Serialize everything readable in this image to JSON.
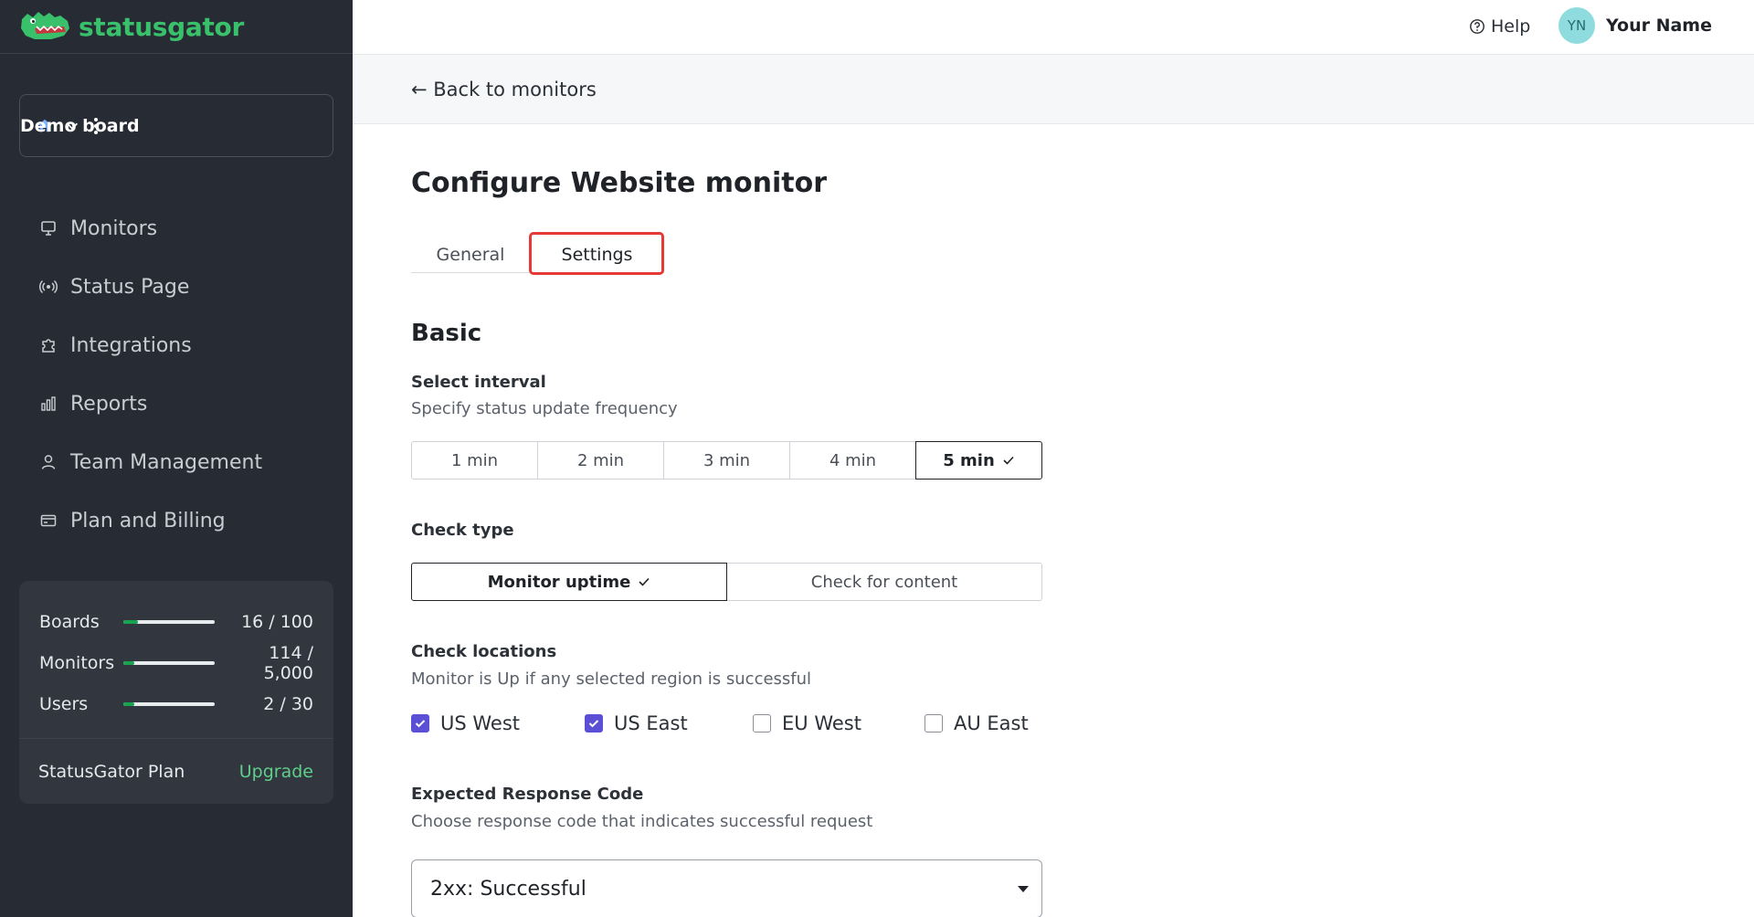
{
  "brand": {
    "name": "statusgator",
    "color": "#39c06b"
  },
  "sidebar": {
    "board": {
      "label": "Demo board",
      "icon": "home-icon"
    },
    "nav": [
      {
        "label": "Monitors",
        "icon": "monitor-icon"
      },
      {
        "label": "Status Page",
        "icon": "broadcast-icon"
      },
      {
        "label": "Integrations",
        "icon": "puzzle-icon"
      },
      {
        "label": "Reports",
        "icon": "bar-chart-icon"
      },
      {
        "label": "Team Management",
        "icon": "user-icon"
      },
      {
        "label": "Plan and Billing",
        "icon": "credit-card-icon"
      }
    ],
    "usage": [
      {
        "name": "Boards",
        "value": "16 / 100",
        "fraction": 0.16
      },
      {
        "name": "Monitors",
        "value": "114 / 5,000",
        "fraction": 0.023
      },
      {
        "name": "Users",
        "value": "2 / 30",
        "fraction": 0.067
      }
    ],
    "plan": {
      "label": "StatusGator Plan",
      "upgrade": "Upgrade"
    }
  },
  "topbar": {
    "help": "Help",
    "user": {
      "initials": "YN",
      "name": "Your Name"
    }
  },
  "back_link": "← Back to monitors",
  "main": {
    "title": "Configure Website monitor",
    "tabs": [
      {
        "label": "General"
      },
      {
        "label": "Settings",
        "active": true
      }
    ],
    "section_title": "Basic",
    "interval": {
      "label": "Select interval",
      "description": "Specify status update frequency",
      "options": [
        "1 min",
        "2 min",
        "3 min",
        "4 min",
        "5 min"
      ],
      "selected": "5 min"
    },
    "check_type": {
      "label": "Check type",
      "options": [
        "Monitor uptime",
        "Check for content"
      ],
      "selected": "Monitor uptime"
    },
    "locations": {
      "label": "Check locations",
      "description": "Monitor is Up if any selected region is successful",
      "options": [
        {
          "label": "US West",
          "checked": true
        },
        {
          "label": "US East",
          "checked": true
        },
        {
          "label": "EU West",
          "checked": false
        },
        {
          "label": "AU East",
          "checked": false
        }
      ]
    },
    "response_code": {
      "label": "Expected Response Code",
      "description": "Choose response code that indicates successful request",
      "selected": "2xx: Successful"
    }
  },
  "colors": {
    "sidebar_bg": "#272b33",
    "accent_check": "#5b4fd6",
    "upgrade": "#5fcf8a",
    "highlight": "#e53935",
    "progress": "#1aa34f"
  }
}
